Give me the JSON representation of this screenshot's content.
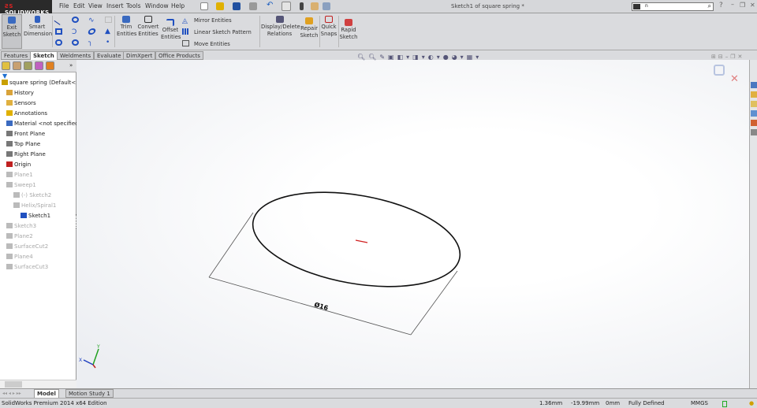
{
  "app": {
    "logo": "SOLIDWORKS",
    "window_title": "Sketch1 of square spring *"
  },
  "menu": [
    "File",
    "Edit",
    "View",
    "Insert",
    "Tools",
    "Window",
    "Help"
  ],
  "search": {
    "value": "n"
  },
  "ribbon": {
    "exit_sketch": "Exit Sketch",
    "smart_dimension": "Smart Dimension",
    "trim": "Trim Entities",
    "convert": "Convert Entities",
    "offset": "Offset Entities",
    "mirror": "Mirror Entities",
    "linear_pattern": "Linear Sketch Pattern",
    "move": "Move Entities",
    "display_relations": "Display/Delete Relations",
    "repair": "Repair Sketch",
    "quick_snaps": "Quick Snaps",
    "rapid": "Rapid Sketch"
  },
  "tabs": [
    "Features",
    "Sketch",
    "Weldments",
    "Evaluate",
    "DimXpert",
    "Office Products"
  ],
  "active_tab": "Sketch",
  "tree": [
    {
      "label": "square spring  (Default<<",
      "state": "normal",
      "indent": 0,
      "icon": "part-icon",
      "color": "#c9a000"
    },
    {
      "label": "History",
      "state": "normal",
      "indent": 1,
      "icon": "history-icon",
      "color": "#d9a33a"
    },
    {
      "label": "Sensors",
      "state": "normal",
      "indent": 1,
      "icon": "sensors-icon",
      "color": "#e0b040"
    },
    {
      "label": "Annotations",
      "state": "normal",
      "indent": 1,
      "icon": "annotations-icon",
      "color": "#e0b000"
    },
    {
      "label": "Material <not specified>",
      "state": "normal",
      "indent": 1,
      "icon": "material-icon",
      "color": "#3a6ac0"
    },
    {
      "label": "Front Plane",
      "state": "normal",
      "indent": 1,
      "icon": "plane-icon",
      "color": "#777"
    },
    {
      "label": "Top Plane",
      "state": "normal",
      "indent": 1,
      "icon": "plane-icon",
      "color": "#777"
    },
    {
      "label": "Right Plane",
      "state": "normal",
      "indent": 1,
      "icon": "plane-icon",
      "color": "#777"
    },
    {
      "label": "Origin",
      "state": "normal",
      "indent": 1,
      "icon": "origin-icon",
      "color": "#c02020"
    },
    {
      "label": "Plane1",
      "state": "dim",
      "indent": 1,
      "icon": "plane-icon",
      "color": "#bbb"
    },
    {
      "label": "Sweep1",
      "state": "dim",
      "indent": 1,
      "icon": "sweep-icon",
      "color": "#bbb"
    },
    {
      "label": "(-) Sketch2",
      "state": "dim",
      "indent": 2,
      "icon": "sketch-icon",
      "color": "#bbb"
    },
    {
      "label": "Helix/Spiral1",
      "state": "dim",
      "indent": 2,
      "icon": "helix-icon",
      "color": "#bbb"
    },
    {
      "label": "Sketch1",
      "state": "normal",
      "indent": 3,
      "icon": "sketch-icon",
      "color": "#2050c0"
    },
    {
      "label": "Sketch3",
      "state": "dim",
      "indent": 1,
      "icon": "sketch-icon",
      "color": "#bbb"
    },
    {
      "label": "Plane2",
      "state": "dim",
      "indent": 1,
      "icon": "plane-icon",
      "color": "#bbb"
    },
    {
      "label": "SurfaceCut2",
      "state": "dim",
      "indent": 1,
      "icon": "surfacecut-icon",
      "color": "#bbb"
    },
    {
      "label": "Plane4",
      "state": "dim",
      "indent": 1,
      "icon": "plane-icon",
      "color": "#bbb"
    },
    {
      "label": "SurfaceCut3",
      "state": "dim",
      "indent": 1,
      "icon": "surfacecut-icon",
      "color": "#bbb"
    }
  ],
  "sketch": {
    "dimension_label": "Ø16"
  },
  "bottom_tabs": [
    "Model",
    "Motion Study 1"
  ],
  "status": {
    "edition": "SolidWorks Premium 2014 x64 Edition",
    "x": "1.36mm",
    "y": "-19.99mm",
    "z": "0mm",
    "state": "Fully Defined",
    "units": "MMGS"
  }
}
